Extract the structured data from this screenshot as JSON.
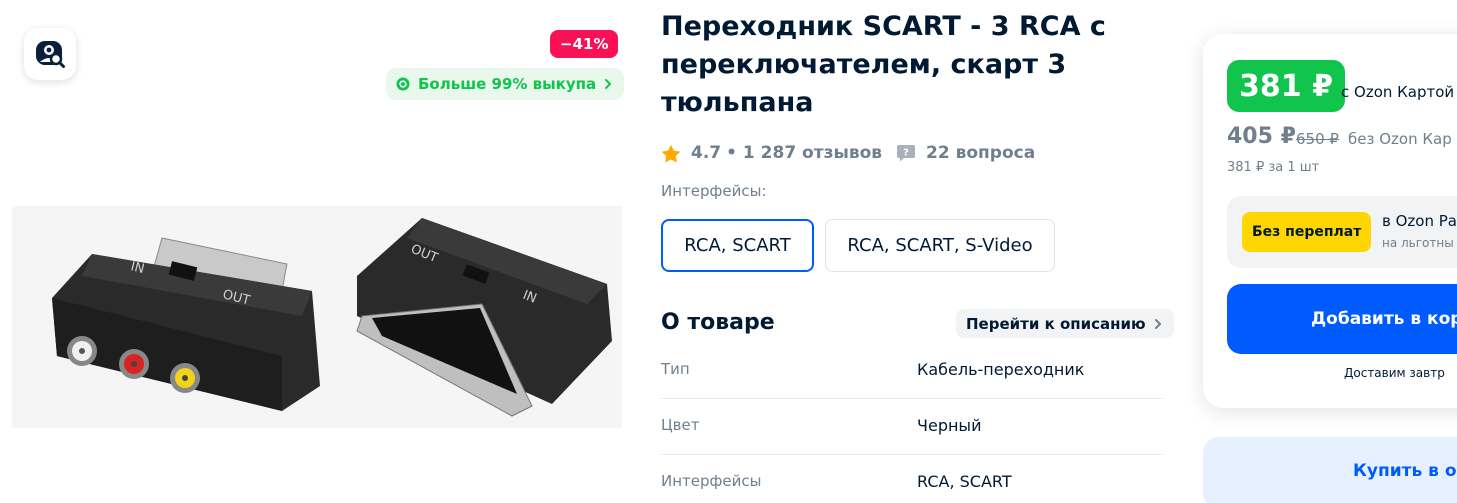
{
  "gallery": {
    "discount": "−41%",
    "buyout_badge": "Больше 99% выкупа",
    "image_alt": "Переходник SCART - 3 RCA"
  },
  "product": {
    "title": "Переходник SCART - 3 RCA с переключателем, скарт 3 тюльпана",
    "rating": "4.7",
    "reviews": "• 1 287 отзывов",
    "questions": "22 вопроса"
  },
  "variants": {
    "label": "Интерфейсы:",
    "options": [
      {
        "label": "RCA, SCART",
        "selected": true
      },
      {
        "label": "RCA, SCART, S-Video",
        "selected": false
      }
    ]
  },
  "about": {
    "title": "О товаре",
    "goto_label": "Перейти к описанию",
    "specs": [
      {
        "key": "Тип",
        "value": "Кабель-переходник"
      },
      {
        "key": "Цвет",
        "value": "Черный"
      },
      {
        "key": "Интерфейсы",
        "value": "RCA, SCART"
      }
    ]
  },
  "price_card": {
    "ozon_price": "381 ₽",
    "ozon_card_label": "с Ozon Картой",
    "base_price": "405 ₽",
    "old_price": "650 ₽",
    "no_card_label": "без Ozon Кар",
    "per_unit": "381 ₽ за 1 шт",
    "installment_badge": "Без переплат",
    "installment_title": "в Ozon Ра",
    "installment_sub": "на льготны",
    "add_to_cart": "Добавить в кор",
    "delivery": "Доставим завтр",
    "buy_one_click": "Купить в од"
  },
  "colors": {
    "accent_blue": "#005bff",
    "discount_pink": "#f91155",
    "ozon_green": "#10c44c",
    "yellow": "#ffd600",
    "text_primary": "#001a34",
    "text_secondary": "#707f8d"
  }
}
